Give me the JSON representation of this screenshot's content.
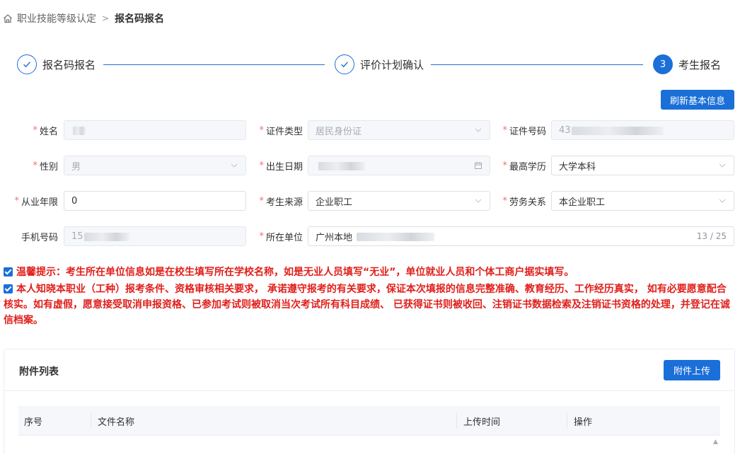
{
  "breadcrumb": {
    "parent": "职业技能等级认定",
    "separator": ">",
    "current": "报名码报名"
  },
  "steps": [
    {
      "label": "报名码报名",
      "status": "done"
    },
    {
      "label": "评价计划确认",
      "status": "done"
    },
    {
      "number": "3",
      "label": "考生报名",
      "status": "active"
    }
  ],
  "actions": {
    "refresh_label": "刷新基本信息",
    "upload_label": "附件上传"
  },
  "form": {
    "name": {
      "label": "姓名",
      "value": "",
      "required": true
    },
    "id_type": {
      "label": "证件类型",
      "value": "居民身份证",
      "required": true
    },
    "id_number": {
      "label": "证件号码",
      "value": "43",
      "required": true
    },
    "gender": {
      "label": "性别",
      "value": "男",
      "required": true
    },
    "birth_date": {
      "label": "出生日期",
      "value": "",
      "required": true
    },
    "education": {
      "label": "最高学历",
      "value": "大学本科",
      "required": true
    },
    "years": {
      "label": "从业年限",
      "value": "0",
      "required": true
    },
    "source": {
      "label": "考生来源",
      "value": "企业职工",
      "required": true
    },
    "labor": {
      "label": "劳务关系",
      "value": "本企业职工",
      "required": true
    },
    "phone": {
      "label": "手机号码",
      "value": "15",
      "required": false
    },
    "org": {
      "label": "所在单位",
      "value": "广州本地",
      "count": "13 / 25",
      "required": true
    }
  },
  "notices": [
    "温馨提示：考生所在单位信息如是在校生填写所在学校名称，如是无业人员填写“无业”，单位就业人员和个体工商户据实填写。",
    "本人知晓本职业（工种）报考条件、资格审核相关要求， 承诺遵守报考的有关要求，保证本次填报的信息完整准确、教育经历、工作经历真实， 如有必要愿意配合核实。如有虚假，愿意接受取消申报资格、已参加考试则被取消当次考试所有科目成绩、 已获得证书则被收回、注销证书数据检索及注销证书资格的处理，并登记在诚信档案。"
  ],
  "attachments": {
    "title": "附件列表",
    "columns": [
      "序号",
      "文件名称",
      "上传时间",
      "操作"
    ]
  },
  "colors": {
    "primary": "#1a6fd8",
    "warning_text": "#e0201c",
    "required_star": "#f56c6c"
  },
  "icons": {
    "home": "home-icon",
    "check": "check-icon",
    "select": "chevron-down-icon",
    "date": "calendar-icon"
  }
}
